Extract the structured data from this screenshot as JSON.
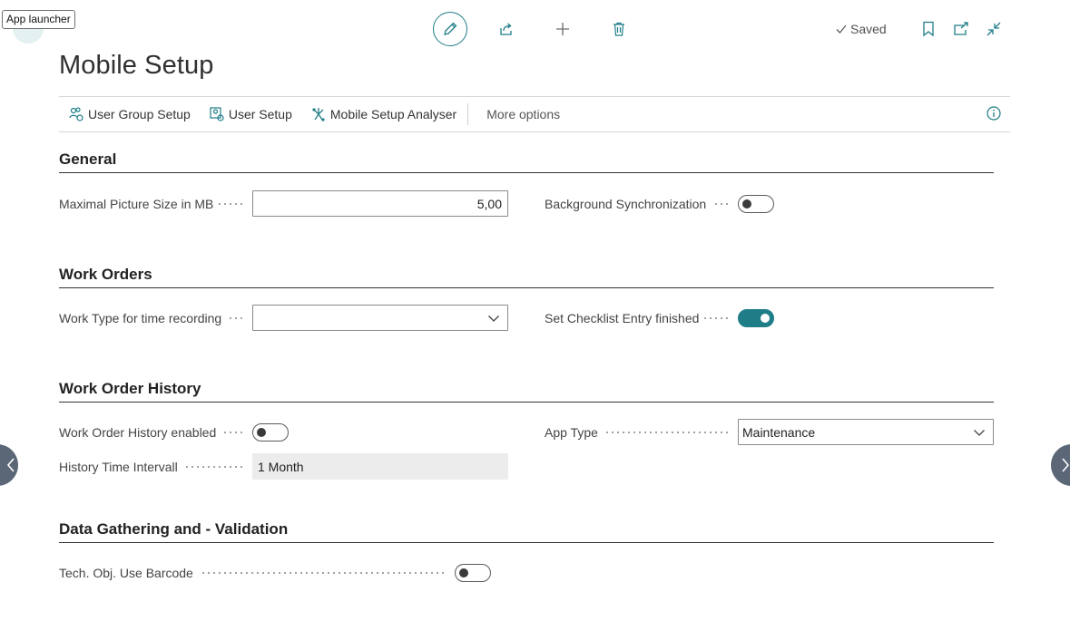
{
  "tooltip": "App launcher",
  "header": {
    "title": "Mobile Setup",
    "saved_label": "Saved",
    "actions": {
      "edit": "edit-icon",
      "share": "share-icon",
      "new": "plus-icon",
      "delete": "trash-icon"
    },
    "right_icons": [
      "bookmark-icon",
      "open-in-new-window-icon",
      "collapse-icon"
    ]
  },
  "action_bar": {
    "items": [
      {
        "label": "User Group Setup",
        "icon": "user-group-setup-icon"
      },
      {
        "label": "User Setup",
        "icon": "user-setup-icon"
      },
      {
        "label": "Mobile Setup Analyser",
        "icon": "analyser-icon"
      }
    ],
    "more_options": "More options"
  },
  "sections": {
    "general": {
      "title": "General",
      "max_picture_size_label": "Maximal Picture Size in MB",
      "max_picture_size_value": "5,00",
      "background_sync_label": "Background Synchronization",
      "background_sync_on": false
    },
    "work_orders": {
      "title": "Work Orders",
      "work_type_label": "Work Type for time recording",
      "work_type_value": "",
      "checklist_label": "Set Checklist Entry finished",
      "checklist_on": true
    },
    "history": {
      "title": "Work Order History",
      "enabled_label": "Work Order History enabled",
      "enabled_on": false,
      "interval_label": "History Time Intervall",
      "interval_value": "1 Month",
      "app_type_label": "App Type",
      "app_type_value": "Maintenance"
    },
    "data_gathering": {
      "title": "Data Gathering and - Validation",
      "barcode_label": "Tech. Obj. Use Barcode",
      "barcode_on": false
    }
  },
  "colors": {
    "accent": "#1f7d87",
    "nav_button": "#5b6677"
  }
}
